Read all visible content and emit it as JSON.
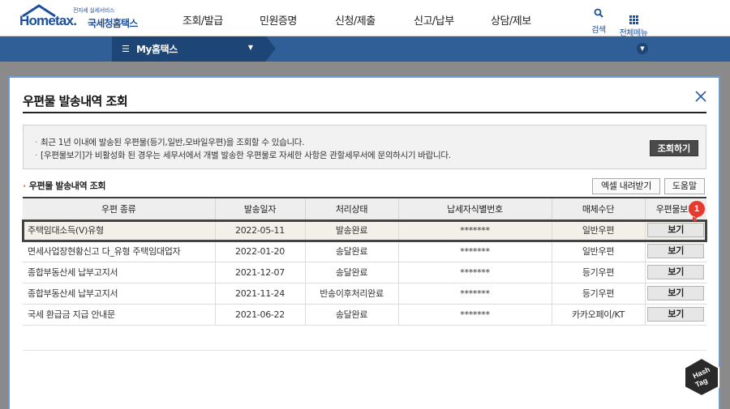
{
  "header": {
    "logo_small": "전자세 실세서비스",
    "logo_main": "Hometax.",
    "logo_kr": "국세청홈택스",
    "nav": [
      "조회/발급",
      "민원증명",
      "신청/제출",
      "신고/납부",
      "상담/제보"
    ],
    "search_label": "검색",
    "menu_label": "전체메뉴"
  },
  "subbar": {
    "my_label": "My홈택스"
  },
  "modal": {
    "title": "우편물 발송내역 조회",
    "info_lines": [
      "최근 1년 이내에 발송된 우편물(등기,일반,모바일우편)을 조회할 수 있습니다.",
      "[우편물보기]가 비활성화 된 경우는 세무서에서 개별 발송한 우편물로 자세한 사항은 관할세무서에 문의하시기 바랍니다."
    ],
    "query_button": "조회하기",
    "section_title": "우편물 발송내역 조회",
    "excel_button": "엑셀 내려받기",
    "help_button": "도움말",
    "columns": [
      "우편 종류",
      "발송일자",
      "처리상태",
      "납세자식별번호",
      "매체수단",
      "우편물보기"
    ],
    "rows": [
      {
        "type": "주택임대소득(V)유형",
        "date": "2022-05-11",
        "status": "발송완료",
        "taxpayer_id": "*******",
        "medium": "일반우편",
        "view": "보기"
      },
      {
        "type": "면세사업장현황신고 다_유형 주택임대업자",
        "date": "2022-01-20",
        "status": "송달완료",
        "taxpayer_id": "*******",
        "medium": "일반우편",
        "view": "보기"
      },
      {
        "type": "종합부동산세 납부고지서",
        "date": "2021-12-07",
        "status": "송달완료",
        "taxpayer_id": "*******",
        "medium": "등기우편",
        "view": "보기"
      },
      {
        "type": "종합부동산세 납부고지서",
        "date": "2021-11-24",
        "status": "반송이후처리완료",
        "taxpayer_id": "*******",
        "medium": "등기우편",
        "view": "보기"
      },
      {
        "type": "국세 환급금 지급 안내문",
        "date": "2021-06-22",
        "status": "송달완료",
        "taxpayer_id": "*******",
        "medium": "카카오페이/KT",
        "view": "보기"
      }
    ]
  },
  "annotation": {
    "badge": "1",
    "watermark": "Hash Tag"
  },
  "colors": {
    "brand_blue": "#1e4f9c",
    "subbar": "#2f5f96",
    "accent_orange": "#e8692a",
    "badge_red": "#e8392f"
  }
}
